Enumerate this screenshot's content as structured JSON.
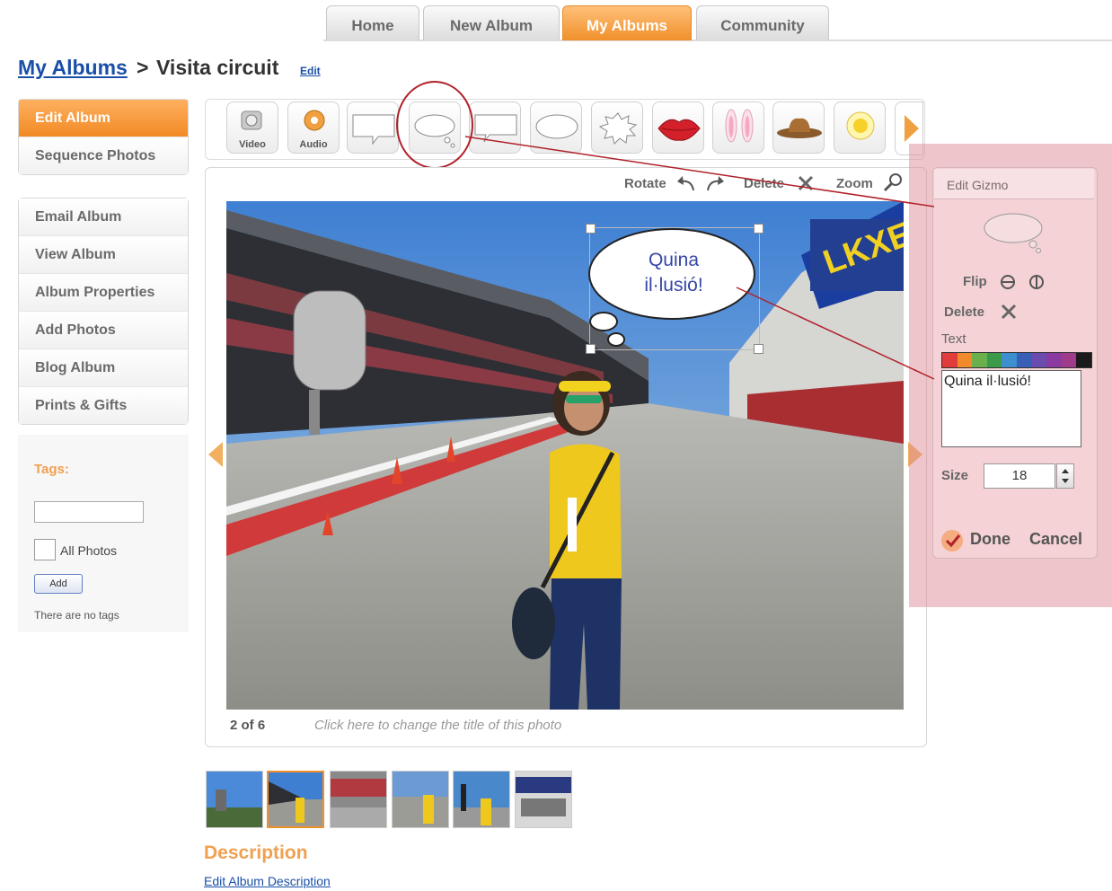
{
  "nav": {
    "tabs": [
      {
        "label": "Home",
        "active": false
      },
      {
        "label": "New Album",
        "active": false
      },
      {
        "label": "My Albums",
        "active": true
      },
      {
        "label": "Community",
        "active": false
      }
    ]
  },
  "breadcrumb": {
    "parent": "My Albums",
    "separator": ">",
    "title": "Visita circuit",
    "edit": "Edit"
  },
  "sidebar": {
    "primary": [
      "Edit Album",
      "Sequence Photos"
    ],
    "secondary": [
      "Email Album",
      "View Album",
      "Album Properties",
      "Add Photos",
      "Blog Album",
      "Prints & Gifts"
    ]
  },
  "tags": {
    "label": "Tags:",
    "input_value": "",
    "all_photos": "All Photos",
    "add_button": "Add",
    "empty_message": "There are no tags"
  },
  "toolbar": {
    "gizmos": [
      {
        "name": "video",
        "label": "Video"
      },
      {
        "name": "audio",
        "label": "Audio"
      },
      {
        "name": "speech-rect"
      },
      {
        "name": "thought-bubble"
      },
      {
        "name": "speech-rect-2"
      },
      {
        "name": "speech-oval"
      },
      {
        "name": "burst-bubble"
      },
      {
        "name": "lips"
      },
      {
        "name": "bunny-ears"
      },
      {
        "name": "cowboy-hat"
      },
      {
        "name": "halo"
      }
    ]
  },
  "photo_tools": {
    "rotate": "Rotate",
    "delete": "Delete",
    "zoom": "Zoom"
  },
  "photo": {
    "counter": "2 of 6",
    "caption_placeholder": "Click here to change the title of this photo",
    "bubble_line1": "Quina",
    "bubble_line2": "il·lusió!"
  },
  "edit_gizmo": {
    "title": "Edit Gizmo",
    "flip": "Flip",
    "delete": "Delete",
    "text_label": "Text",
    "text_value": "Quina il·lusió!",
    "size_label": "Size",
    "size_value": "18",
    "done": "Done",
    "cancel": "Cancel",
    "palette": [
      "#e23b3b",
      "#f08a2c",
      "#6ab04c",
      "#3a9a4a",
      "#3d8fd0",
      "#3a5fb8",
      "#6a4cb0",
      "#8a3aa0",
      "#a03a8a",
      "#1a1a1a"
    ]
  },
  "thumbnails": {
    "count": 6,
    "selected_index": 1
  },
  "description": {
    "heading": "Description",
    "edit_link": "Edit Album Description"
  },
  "colors": {
    "accent": "#f0902a",
    "link": "#1a4fa8",
    "annotation": "#b0222a"
  }
}
